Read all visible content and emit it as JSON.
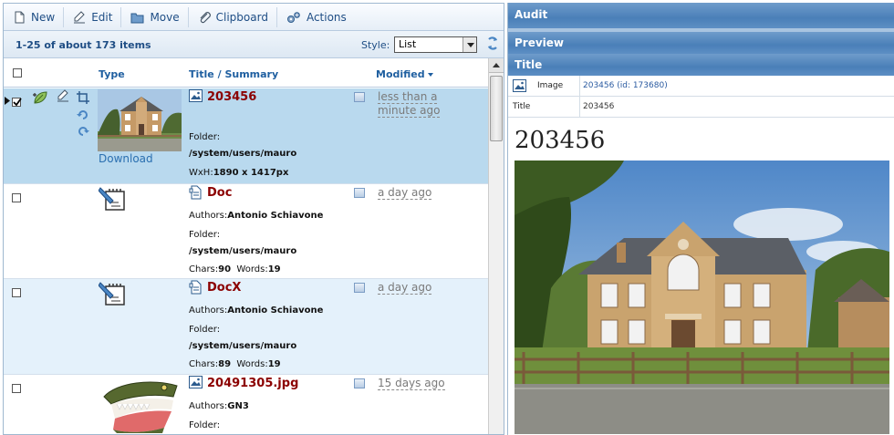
{
  "toolbar": {
    "new_label": "New",
    "edit_label": "Edit",
    "move_label": "Move",
    "clipboard_label": "Clipboard",
    "actions_label": "Actions"
  },
  "listbar": {
    "count": "1-25 of about 173 items",
    "style_label": "Style:",
    "style_value": "List"
  },
  "columns": {
    "type": "Type",
    "title": "Title / Summary",
    "modified": "Modified"
  },
  "rows": [
    {
      "title": "203456",
      "download": "Download",
      "folder_label": "Folder:",
      "folder": "/system/users/mauro",
      "dims_label": "WxH:",
      "dims": "1890 x 1417px",
      "modified": "less than a minute ago",
      "modified_line1": "less than a",
      "modified_line2": "minute ago"
    },
    {
      "title": "Doc",
      "authors_label": "Authors:",
      "authors": "Antonio Schiavone",
      "folder_label": "Folder:",
      "folder": "/system/users/mauro",
      "chars_label": "Chars:",
      "chars": "90",
      "words_label": "Words:",
      "words": "19",
      "modified": "a day ago"
    },
    {
      "title": "DocX",
      "authors_label": "Authors:",
      "authors": "Antonio Schiavone",
      "folder_label": "Folder:",
      "folder": "/system/users/mauro",
      "chars_label": "Chars:",
      "chars": "89",
      "words_label": "Words:",
      "words": "19",
      "modified": "a day ago"
    },
    {
      "title": "20491305.jpg",
      "authors_label": "Authors:",
      "authors": "GN3",
      "folder_label": "Folder:",
      "modified": "15 days ago"
    }
  ],
  "right": {
    "audit": "Audit",
    "preview": "Preview",
    "title_section": "Title",
    "image_key": "Image",
    "image_value": "203456 (id: 173680)",
    "title_key": "Title",
    "title_value": "203456",
    "big_title": "203456"
  },
  "colors": {
    "accent": "#1f4e85",
    "selected_row": "#b9d9ee",
    "alt_row": "#e4f1fb",
    "title_red": "#8b0000",
    "band_blue": "#4a7fb8"
  }
}
